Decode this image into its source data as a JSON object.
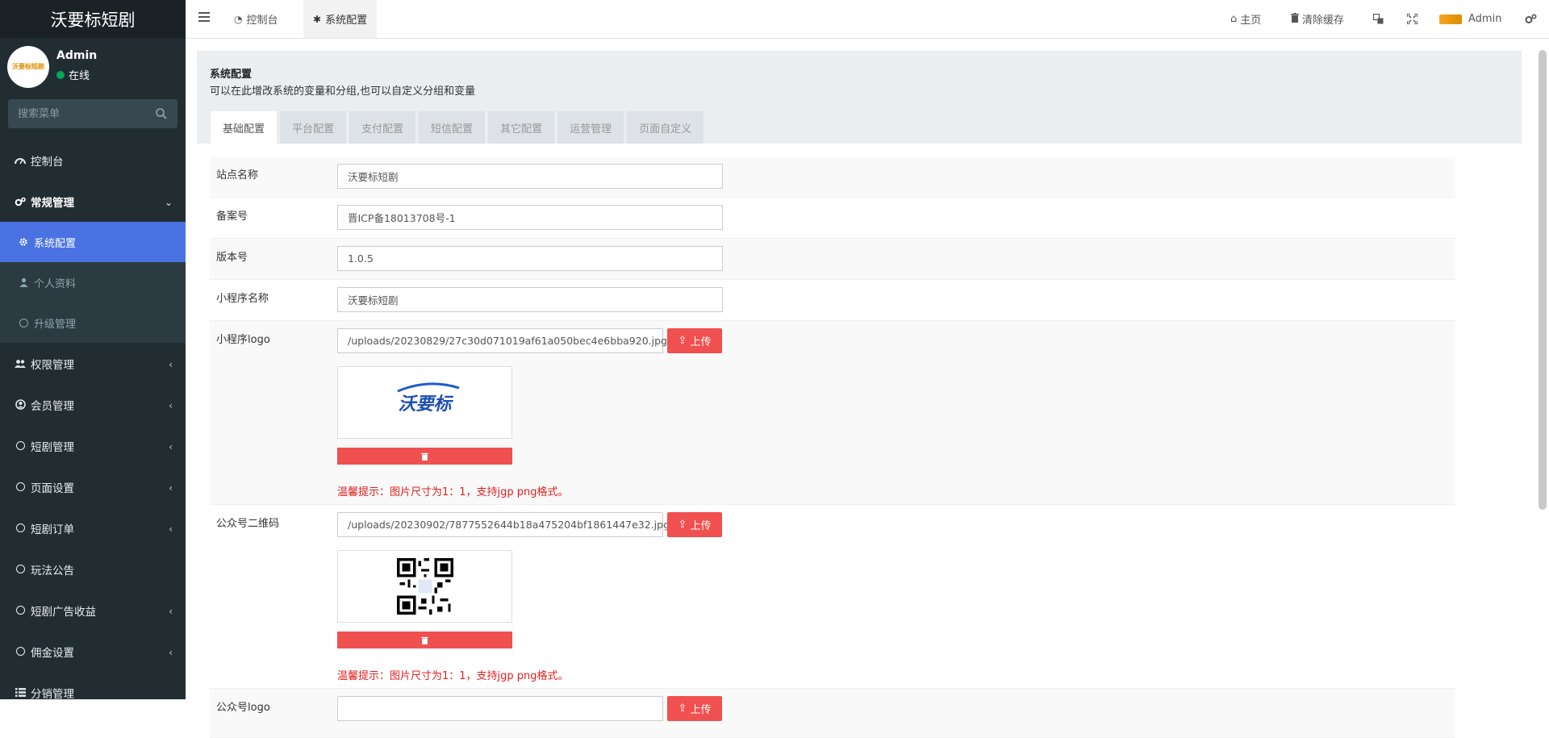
{
  "app": {
    "title": "沃要标短剧"
  },
  "user": {
    "name": "Admin",
    "status": "在线",
    "avatar_text": "沃要标短剧"
  },
  "search": {
    "placeholder": "搜索菜单"
  },
  "menu": {
    "dashboard": "控制台",
    "general": "常规管理",
    "general_sub": [
      "系统配置",
      "个人资料",
      "升级管理"
    ],
    "items": [
      "权限管理",
      "会员管理",
      "短剧管理",
      "页面设置",
      "短剧订单",
      "玩法公告",
      "短剧广告收益",
      "佣金设置",
      "分销管理"
    ]
  },
  "header": {
    "tabs": [
      "控制台",
      "系统配置"
    ],
    "right": {
      "home": "主页",
      "clear_cache": "清除缓存",
      "admin": "Admin"
    }
  },
  "page": {
    "title": "系统配置",
    "description": "可以在此增改系统的变量和分组,也可以自定义分组和变量",
    "tabs": [
      "基础配置",
      "平台配置",
      "支付配置",
      "短信配置",
      "其它配置",
      "运营管理",
      "页面自定义"
    ]
  },
  "form": {
    "site_name": {
      "label": "站点名称",
      "value": "沃要标短剧"
    },
    "icp": {
      "label": "备案号",
      "value": "晋ICP备18013708号-1"
    },
    "version": {
      "label": "版本号",
      "value": "1.0.5"
    },
    "mp_name": {
      "label": "小程序名称",
      "value": "沃要标短剧"
    },
    "mp_logo": {
      "label": "小程序logo",
      "value": "/uploads/20230829/27c30d071019af61a050bec4e6bba920.jpg",
      "preview_text": "沃要标"
    },
    "qrcode": {
      "label": "公众号二维码",
      "value": "/uploads/20230902/7877552644b18a475204bf1861447e32.jpg"
    },
    "gzh_logo": {
      "label": "公众号logo"
    },
    "upload_label": "上传",
    "tip": "温馨提示：图片尺寸为1：1，支持jgp png格式。"
  },
  "colors": {
    "sidebar": "#222d32",
    "active": "#4a72e2",
    "danger": "#f05050"
  }
}
